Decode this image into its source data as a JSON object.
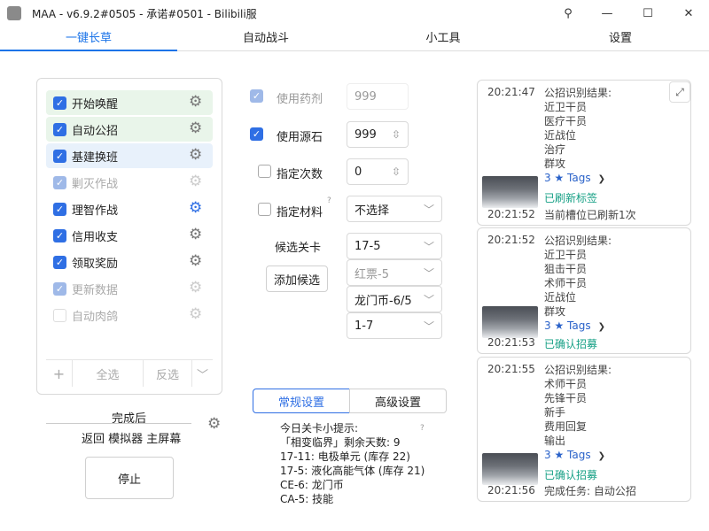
{
  "window": {
    "title": "MAA - v6.9.2#0505 - 承诺#0501 - Bilibili服",
    "buttons": {
      "pin": "⚲",
      "minimize": "—",
      "maximize": "☐",
      "close": "✕"
    }
  },
  "tabs": [
    "一键长草",
    "自动战斗",
    "小工具",
    "设置"
  ],
  "tasks": [
    {
      "label": "开始唤醒"
    },
    {
      "label": "自动公招"
    },
    {
      "label": "基建换班"
    },
    {
      "label": "剿灭作战"
    },
    {
      "label": "理智作战"
    },
    {
      "label": "信用收支"
    },
    {
      "label": "领取奖励"
    },
    {
      "label": "更新数据"
    },
    {
      "label": "自动肉鸽"
    }
  ],
  "task_bottom": {
    "add": "+",
    "select_all": "全选",
    "invert": "反选",
    "more": "﹀"
  },
  "after_finish": {
    "label": "完成后",
    "value": "返回 模拟器 主屏幕"
  },
  "stop_button": "停止",
  "settings": {
    "use_medicine": {
      "label": "使用药剂",
      "value": "999"
    },
    "use_stone": {
      "label": "使用源石",
      "value": "999"
    },
    "times": {
      "label": "指定次数",
      "value": "0"
    },
    "material": {
      "label": "指定材料",
      "help": "?",
      "value": "不选择"
    },
    "stage_label": "候选关卡",
    "add_stage": "添加候选",
    "stages": [
      "17-5",
      "红票-5",
      "龙门币-6/5",
      "1-7"
    ]
  },
  "subtabs": [
    "常规设置",
    "高级设置"
  ],
  "tips": {
    "title": "今日关卡小提示:",
    "help": "?",
    "lines": [
      "「相变临界」剩余天数: 9",
      "17-11: 电极单元 (库存 22)",
      "17-5: 液化高能气体 (库存 21)",
      "CE-6: 龙门币",
      "CA-5: 技能"
    ]
  },
  "logs": [
    {
      "time": "20:21:47",
      "lines": [
        "公招识别结果:",
        "近卫干员",
        "医疗干员",
        "近战位",
        "治疗",
        "群攻"
      ],
      "tags": "3 ★ Tags",
      "status_time": "20:21:52",
      "status": "已刷新标签",
      "extra": "当前槽位已刷新1次"
    },
    {
      "time": "20:21:52",
      "lines": [
        "公招识别结果:",
        "近卫干员",
        "狙击干员",
        "术师干员",
        "近战位",
        "群攻"
      ],
      "tags": "3 ★ Tags",
      "status_time": "20:21:53",
      "status": "已确认招募"
    },
    {
      "time": "20:21:55",
      "lines": [
        "公招识别结果:",
        "术师干员",
        "先锋干员",
        "新手",
        "费用回复",
        "输出"
      ],
      "tags": "3 ★ Tags",
      "status_time": "20:21:56",
      "status": "已确认招募",
      "extra": "完成任务: 自动公招"
    }
  ]
}
